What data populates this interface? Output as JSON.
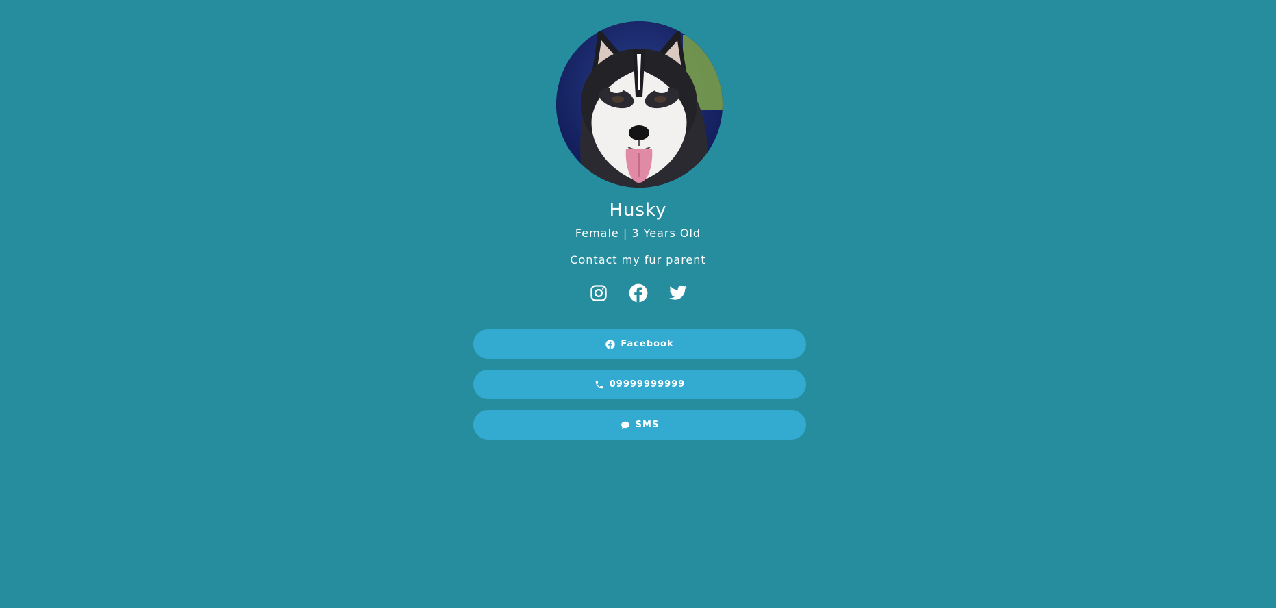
{
  "profile": {
    "name": "Husky",
    "details": "Female | 3 Years Old",
    "contact_heading": "Contact my fur parent",
    "avatar_icon": "husky-photo"
  },
  "social_icons": [
    {
      "icon": "instagram-icon"
    },
    {
      "icon": "facebook-icon"
    },
    {
      "icon": "twitter-icon"
    }
  ],
  "buttons": [
    {
      "label": "Facebook",
      "icon": "facebook-icon"
    },
    {
      "label": "09999999999",
      "icon": "phone-icon"
    },
    {
      "label": "SMS",
      "icon": "chat-icon"
    }
  ],
  "colors": {
    "background": "#268d9f",
    "button": "#33aad0",
    "text": "#ffffff"
  }
}
